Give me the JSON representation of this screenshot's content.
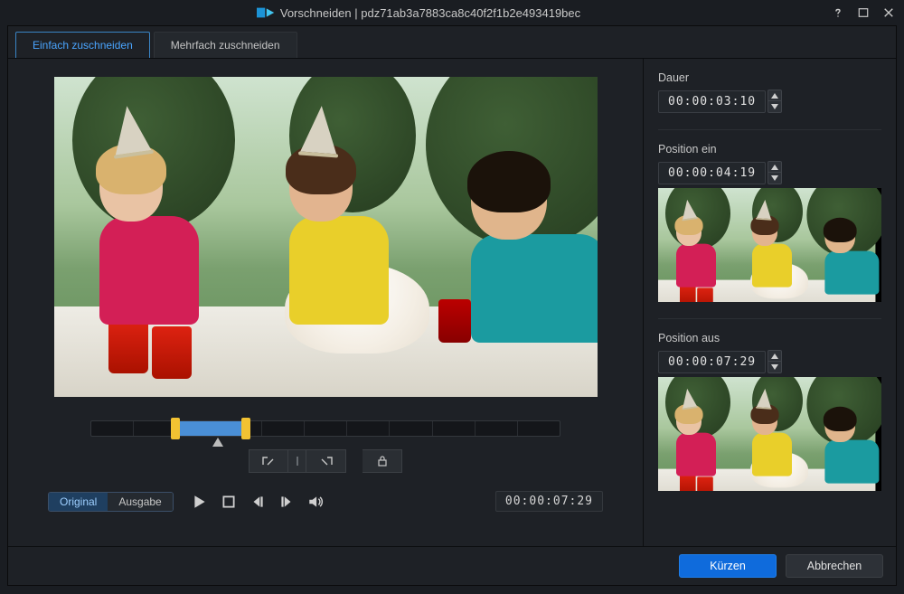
{
  "window": {
    "title": "Vorschneiden | pdz71ab3a7883ca8c40f2f1b2e493419bec"
  },
  "tabs": {
    "simple": "Einfach zuschneiden",
    "multi": "Mehrfach zuschneiden"
  },
  "playback": {
    "original": "Original",
    "output": "Ausgabe",
    "timecode": "00:00:07:29"
  },
  "right": {
    "duration_label": "Dauer",
    "duration_value": "00:00:03:10",
    "in_label": "Position ein",
    "in_value": "00:00:04:19",
    "out_label": "Position aus",
    "out_value": "00:00:07:29"
  },
  "footer": {
    "trim": "Kürzen",
    "cancel": "Abbrechen"
  }
}
